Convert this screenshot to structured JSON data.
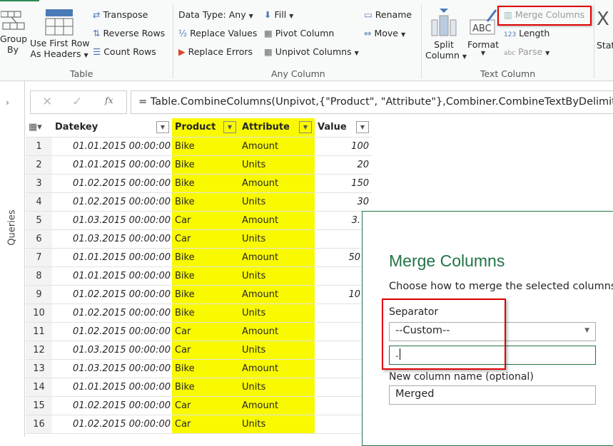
{
  "ribbon": {
    "table_group": {
      "label": "Table",
      "group_by": "Group\nBy",
      "group_by_l1": "Group",
      "group_by_l2": "By",
      "first_row_l1": "Use First Row",
      "first_row_l2": "As Headers",
      "transpose": "Transpose",
      "reverse_rows": "Reverse Rows",
      "count_rows": "Count Rows"
    },
    "any_column_group": {
      "label": "Any Column",
      "data_type": "Data Type: Any",
      "replace_values": "Replace Values",
      "replace_errors": "Replace Errors",
      "fill": "Fill",
      "pivot_column": "Pivot Column",
      "unpivot_columns": "Unpivot Columns",
      "rename": "Rename",
      "move": "Move"
    },
    "text_column_group": {
      "label": "Text Column",
      "split_l1": "Split",
      "split_l2": "Column",
      "format": "Format",
      "merge_columns": "Merge Columns",
      "length": "Length",
      "parse": "Parse"
    },
    "stats_partial": "Stat"
  },
  "sidebar": {
    "label": "Queries"
  },
  "formula_bar": {
    "formula": "= Table.CombineColumns(Unpivot,{\"Product\", \"Attribute\"},Combiner.CombineTextByDelimiter"
  },
  "table": {
    "columns": [
      "Datekey",
      "Product",
      "Attribute",
      "Value"
    ],
    "rows": [
      {
        "n": "1",
        "date": "01.01.2015 00:00:00",
        "product": "Bike",
        "attribute": "Amount",
        "value": "100"
      },
      {
        "n": "2",
        "date": "01.01.2015 00:00:00",
        "product": "Bike",
        "attribute": "Units",
        "value": "20"
      },
      {
        "n": "3",
        "date": "01.02.2015 00:00:00",
        "product": "Bike",
        "attribute": "Amount",
        "value": "150"
      },
      {
        "n": "4",
        "date": "01.02.2015 00:00:00",
        "product": "Bike",
        "attribute": "Units",
        "value": "30"
      },
      {
        "n": "5",
        "date": "01.03.2015 00:00:00",
        "product": "Car",
        "attribute": "Amount",
        "value": "3."
      },
      {
        "n": "6",
        "date": "01.03.2015 00:00:00",
        "product": "Car",
        "attribute": "Units",
        "value": ""
      },
      {
        "n": "7",
        "date": "01.01.2015 00:00:00",
        "product": "Bike",
        "attribute": "Amount",
        "value": "50"
      },
      {
        "n": "8",
        "date": "01.01.2015 00:00:00",
        "product": "Bike",
        "attribute": "Units",
        "value": ""
      },
      {
        "n": "9",
        "date": "01.02.2015 00:00:00",
        "product": "Bike",
        "attribute": "Amount",
        "value": "10"
      },
      {
        "n": "10",
        "date": "01.02.2015 00:00:00",
        "product": "Bike",
        "attribute": "Units",
        "value": ""
      },
      {
        "n": "11",
        "date": "01.02.2015 00:00:00",
        "product": "Car",
        "attribute": "Amount",
        "value": ""
      },
      {
        "n": "12",
        "date": "01.03.2015 00:00:00",
        "product": "Car",
        "attribute": "Units",
        "value": ""
      },
      {
        "n": "13",
        "date": "01.03.2015 00:00:00",
        "product": "Bike",
        "attribute": "Amount",
        "value": ""
      },
      {
        "n": "14",
        "date": "01.01.2015 00:00:00",
        "product": "Bike",
        "attribute": "Units",
        "value": ""
      },
      {
        "n": "15",
        "date": "01.02.2015 00:00:00",
        "product": "Car",
        "attribute": "Amount",
        "value": ""
      },
      {
        "n": "16",
        "date": "01.02.2015 00:00:00",
        "product": "Car",
        "attribute": "Units",
        "value": ""
      }
    ]
  },
  "dialog": {
    "title": "Merge Columns",
    "description": "Choose how to merge the selected columns",
    "separator_label": "Separator",
    "separator_value": "--Custom--",
    "custom_value": ".",
    "new_column_label": "New column name (optional)",
    "new_column_value": "Merged"
  },
  "colors": {
    "selected_column": "#f9f900",
    "highlight": "#e00000",
    "accent": "#217346"
  }
}
